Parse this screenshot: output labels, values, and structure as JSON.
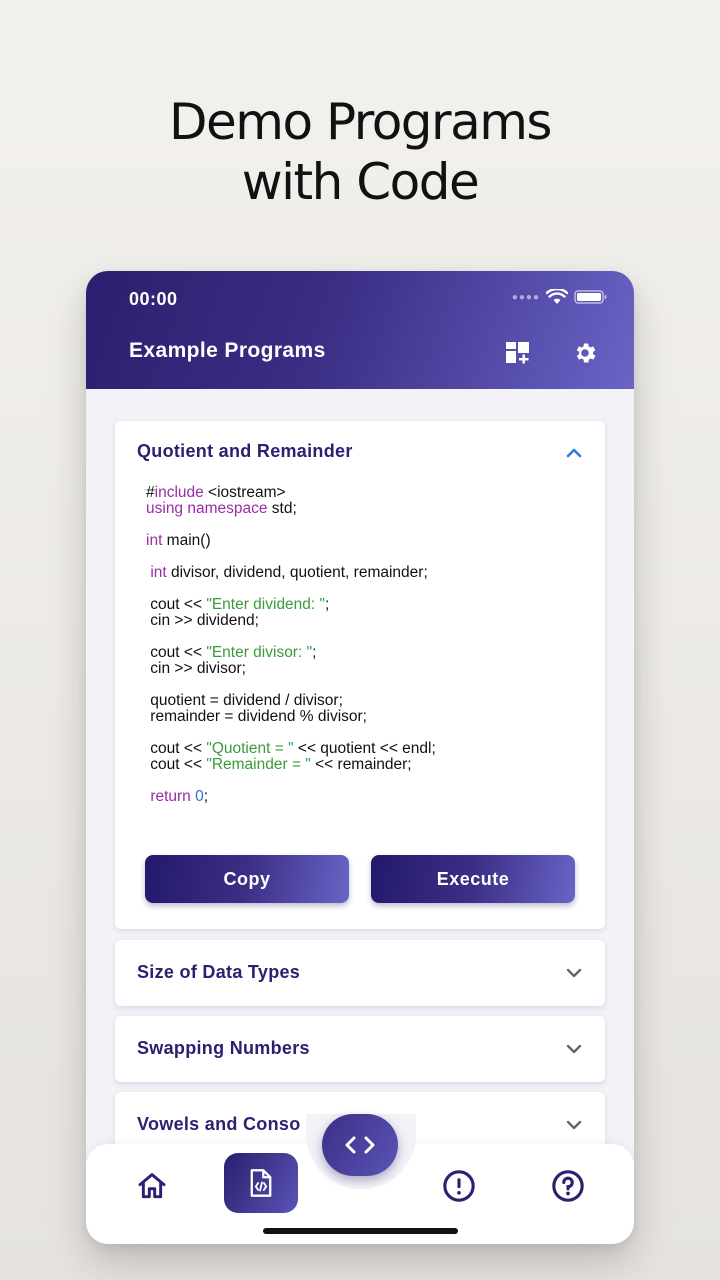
{
  "headline": {
    "line1": "Demo Programs",
    "line2": "with Code"
  },
  "status_bar": {
    "time": "00:00"
  },
  "app_bar": {
    "title": "Example Programs"
  },
  "expanded_program": {
    "title": "Quotient and Remainder",
    "code_lines": [
      [
        {
          "t": "#"
        },
        {
          "t": "include",
          "c": "kw"
        },
        {
          "t": " <iostream>"
        }
      ],
      [
        {
          "t": "using namespace",
          "c": "kw"
        },
        {
          "t": " std;"
        }
      ],
      [],
      [
        {
          "t": "int",
          "c": "kw"
        },
        {
          "t": " main()"
        }
      ],
      [],
      [
        {
          "t": " "
        },
        {
          "t": "int",
          "c": "kw"
        },
        {
          "t": " divisor, dividend, quotient, remainder;"
        }
      ],
      [],
      [
        {
          "t": " cout << "
        },
        {
          "t": "\"Enter dividend: \"",
          "c": "str"
        },
        {
          "t": ";"
        }
      ],
      [
        {
          "t": " cin >> dividend;"
        }
      ],
      [],
      [
        {
          "t": " cout << "
        },
        {
          "t": "\"Enter divisor: \"",
          "c": "str"
        },
        {
          "t": ";"
        }
      ],
      [
        {
          "t": " cin >> divisor;"
        }
      ],
      [],
      [
        {
          "t": " quotient = dividend / divisor;"
        }
      ],
      [
        {
          "t": " remainder = dividend % divisor;"
        }
      ],
      [],
      [
        {
          "t": " cout << "
        },
        {
          "t": "\"Quotient = \"",
          "c": "str"
        },
        {
          "t": " << quotient << endl;"
        }
      ],
      [
        {
          "t": " cout << "
        },
        {
          "t": "\"Remainder = \"",
          "c": "str"
        },
        {
          "t": " << remainder;"
        }
      ],
      [],
      [
        {
          "t": " "
        },
        {
          "t": "return",
          "c": "kw"
        },
        {
          "t": " "
        },
        {
          "t": "0",
          "c": "num"
        },
        {
          "t": ";"
        }
      ]
    ],
    "copy_label": "Copy",
    "execute_label": "Execute"
  },
  "programs": [
    {
      "title": "Size of Data Types"
    },
    {
      "title": "Swapping Numbers"
    },
    {
      "title": "Vowels and Conso"
    }
  ],
  "colors": {
    "primary": "#2b2170",
    "gradient_end": "#6a64c6",
    "accent_chevron": "#2f7bd6"
  },
  "bottom_nav": {
    "items": [
      "home-icon",
      "code-file-icon",
      "info-icon",
      "help-icon"
    ],
    "fab_icon": "code-brackets-icon"
  }
}
